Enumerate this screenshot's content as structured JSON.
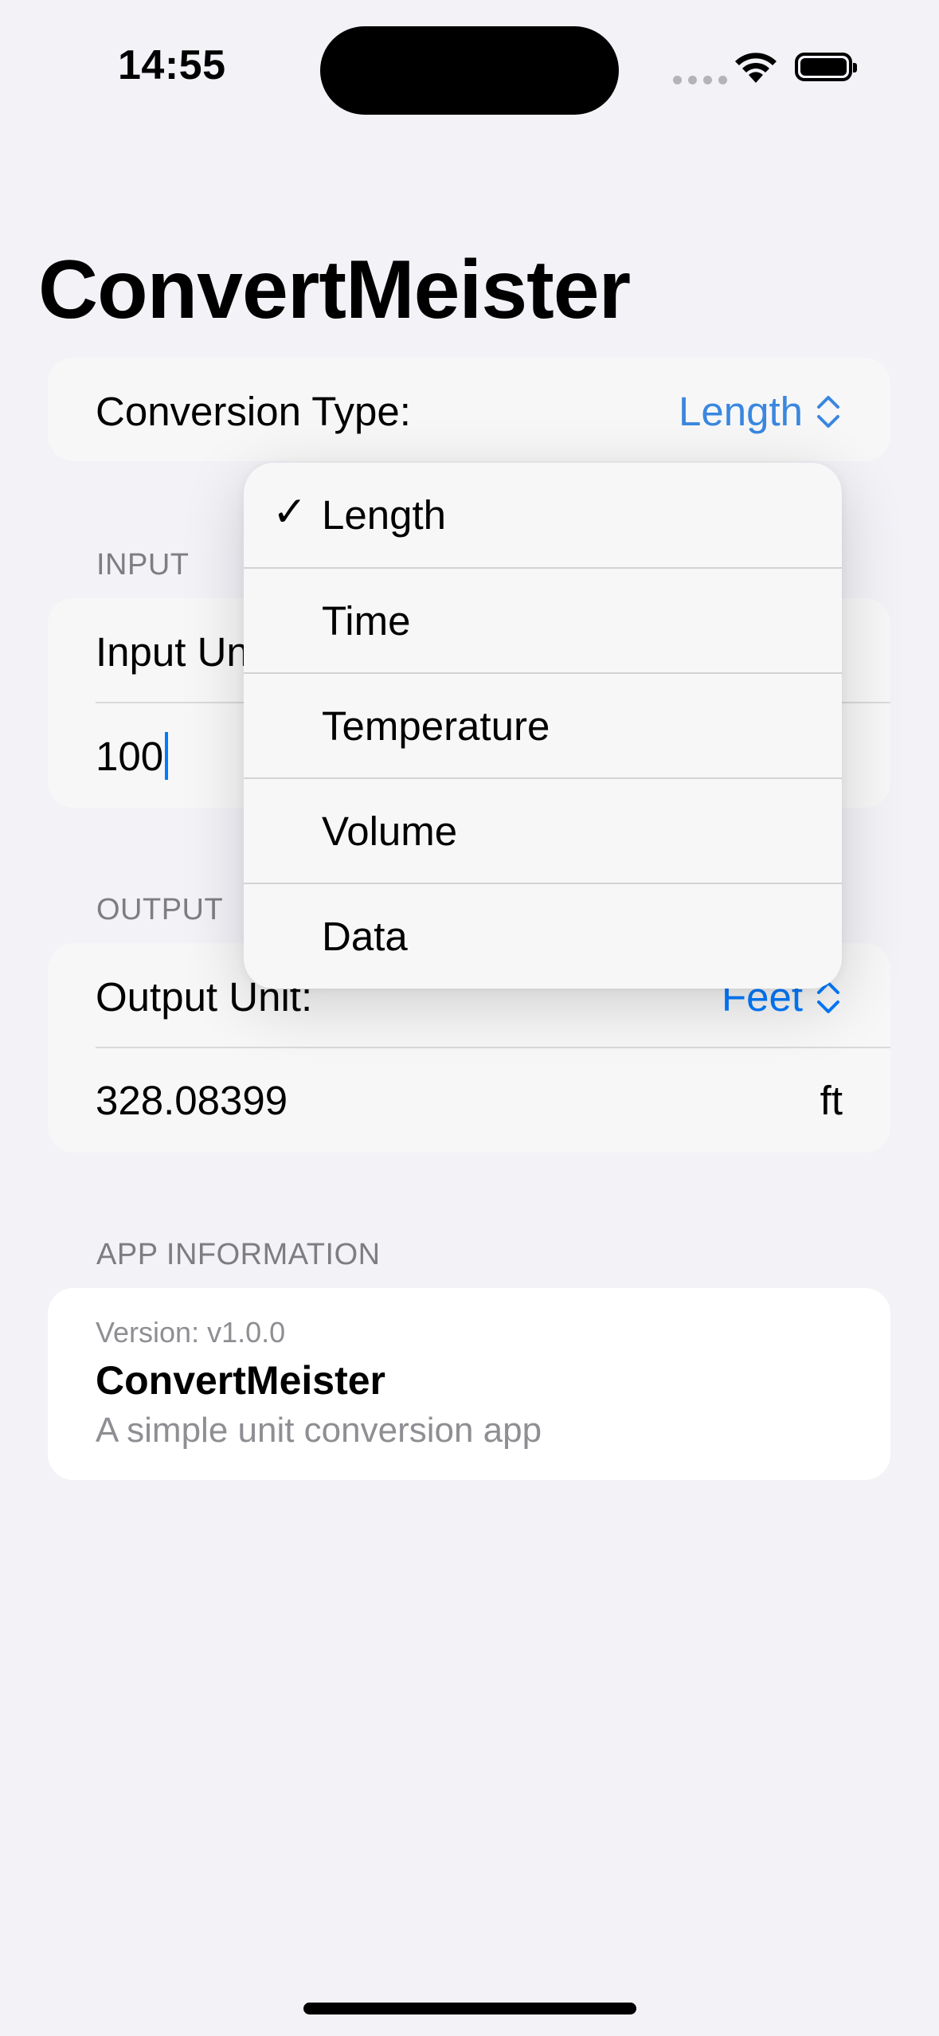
{
  "status_bar": {
    "time": "14:55"
  },
  "title": "ConvertMeister",
  "conversion": {
    "label": "Conversion Type:",
    "selected": "Length"
  },
  "input_section": {
    "header": "INPUT",
    "unit_label": "Input Unit:",
    "value": "100"
  },
  "output_section": {
    "header": "OUTPUT",
    "unit_label": "Output Unit:",
    "unit_selected": "Feet",
    "value": "328.08399",
    "unit_symbol": "ft"
  },
  "app_info": {
    "header": "APP INFORMATION",
    "version": "Version: v1.0.0",
    "name": "ConvertMeister",
    "description": "A simple unit conversion app"
  },
  "menu": {
    "checked_mark": "✓",
    "items": [
      {
        "label": "Length",
        "checked": true
      },
      {
        "label": "Time",
        "checked": false
      },
      {
        "label": "Temperature",
        "checked": false
      },
      {
        "label": "Volume",
        "checked": false
      },
      {
        "label": "Data",
        "checked": false
      }
    ]
  },
  "colors": {
    "accent": "#007aff",
    "dimmed_accent": "#3a87df",
    "background": "#f2f2f7"
  },
  "icons": [
    "wifi-icon",
    "battery-icon",
    "chevron-up-down-icon",
    "checkmark-icon"
  ]
}
